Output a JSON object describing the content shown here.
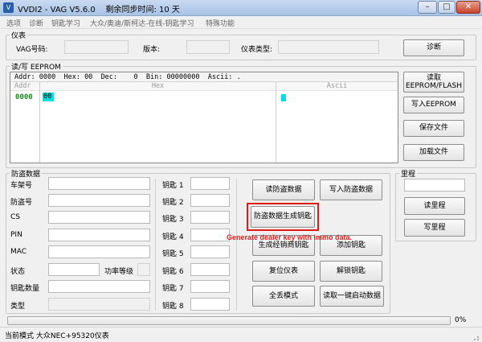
{
  "window": {
    "app_icon_glyph": "V",
    "title": "VVDI2 - VAG V5.6.0",
    "sync_time": "剩余同步时间: 10 天",
    "controls": {
      "minimize": "–",
      "maximize": "□",
      "close": "✕"
    }
  },
  "menu": [
    "选项",
    "诊断",
    "钥匙学习",
    "大众/奥迪/斯柯达-在线-钥匙学习",
    "特殊功能"
  ],
  "instrument": {
    "group_title": "仪表",
    "vag_label": "VAG号码:",
    "vag_value": "",
    "version_label": "版本:",
    "version_value": "",
    "type_label": "仪表类型:",
    "type_value": "",
    "diagnose_button": "诊断"
  },
  "eeprom": {
    "group_title": "读/写 EEPROM",
    "info": {
      "addr_label": "Addr:",
      "addr_value": "0000",
      "hex_label": "Hex:",
      "hex_value": "00",
      "dec_label": "Dec:",
      "dec_value": "0",
      "bin_label": "Bin:",
      "bin_value": "00000000",
      "ascii_label": "Ascii:",
      "ascii_value": "."
    },
    "columns": {
      "addr": "Addr",
      "hex": "Hex",
      "ascii": "Ascii"
    },
    "row_addr": "0000",
    "row_byte": "00",
    "buttons": {
      "read": "读取\nEEPROM/FLASH",
      "write": "写入EEPROM",
      "save": "保存文件",
      "load": "加载文件"
    }
  },
  "immo": {
    "group_title": "防盗数据",
    "fields": [
      {
        "label": "车架号",
        "value": ""
      },
      {
        "label": "防盗号",
        "value": ""
      },
      {
        "label": "CS",
        "value": ""
      },
      {
        "label": "PIN",
        "value": ""
      },
      {
        "label": "MAC",
        "value": ""
      },
      {
        "label": "状态",
        "value": ""
      },
      {
        "label": "钥匙数量",
        "value": ""
      },
      {
        "label": "类型",
        "value": ""
      }
    ],
    "power_level_label": "功率等级",
    "power_level_value": "",
    "keys": [
      {
        "label": "钥匙 1",
        "value": ""
      },
      {
        "label": "钥匙 2",
        "value": ""
      },
      {
        "label": "钥匙 3",
        "value": ""
      },
      {
        "label": "钥匙 4",
        "value": ""
      },
      {
        "label": "钥匙 5",
        "value": ""
      },
      {
        "label": "钥匙 6",
        "value": ""
      },
      {
        "label": "钥匙 7",
        "value": ""
      },
      {
        "label": "钥匙 8",
        "value": ""
      }
    ],
    "buttons": {
      "read_immo": "读防盗数据",
      "write_immo": "写入防盗数据",
      "gen_key": "防盗数据生成钥匙",
      "gen_dealer_key": "生成经销商钥匙",
      "add_key": "添加钥匙",
      "reset_instrument": "复位仪表",
      "unlock_key": "解锁钥匙",
      "all_keys_lost": "全丢模式",
      "read_one_key_start": "读取一键启动数据"
    }
  },
  "mileage": {
    "group_title": "里程",
    "value": "",
    "read_button": "读里程",
    "write_button": "写里程"
  },
  "annotation": "Generate dealer key with immo data.",
  "progress": {
    "percent_text": "0%",
    "fraction": 0
  },
  "status": "当前模式 大众NEC+95320仪表",
  "colors": {
    "highlight": "#e01818",
    "annotation": "#e41c1c",
    "hex_cursor": "#00dcdc",
    "address": "#1a8a1a"
  }
}
